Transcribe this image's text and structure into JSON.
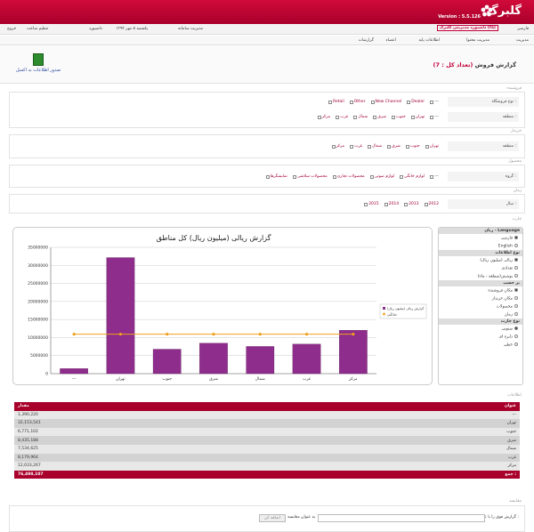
{
  "header": {
    "logo": "گلبرگ",
    "version": "Version : 5.5.126",
    "user_btn": "داشبورد مدیریتی گلبرگ (fa)",
    "language": "فارسی",
    "date": "یکشنبه ۵ مهر ۱۳۹۴",
    "dashboard_link": "داشبورد",
    "settings_link": "تنظیم ساعت",
    "logout": "خروج",
    "system_mgmt": "مدیریت سامانه"
  },
  "menu": {
    "items": [
      "مدیریت",
      "مدیریت محتوا",
      "اطلاعات پایه",
      "اعضاء",
      "گزارشات"
    ]
  },
  "page": {
    "title": "گزارش فروش",
    "count": "(تعداد کل : 7)",
    "excel": "صدور اطلاعات به اکسل"
  },
  "filters": {
    "store_section": "فروشنده",
    "store_type_label": "نوع فروشگاه :",
    "store_types": [
      "---",
      "Dealer",
      "New Channel",
      "Other",
      "Retail"
    ],
    "region_label": "منطقه :",
    "regions": [
      "---",
      "تهران",
      "جنوب",
      "شرق",
      "شمال",
      "غرب",
      "مرکز"
    ],
    "buyer_section": "خریدار",
    "buyer_region_label": "منطقه :",
    "buyer_regions": [
      "تهران",
      "جنوب",
      "شرق",
      "شمال",
      "غرب",
      "مرکز"
    ],
    "product_section": "محصول",
    "group_label": "گروه :",
    "groups": [
      "---",
      "لوازم خانگی",
      "لوازم صوتی",
      "محصولات تجاری",
      "محصولات سلامتی",
      "نمایشگرها"
    ],
    "time_section": "زمان",
    "year_label": "سال :",
    "years": [
      "2012",
      "2013",
      "2014",
      "2015"
    ]
  },
  "chart_section_label": "چارت",
  "chart_data": {
    "type": "bar",
    "title": "گزارش ریالی (میلیون ریال) کل مناطق",
    "categories": [
      "---",
      "تهران",
      "جنوب",
      "شرق",
      "شمال",
      "غرب",
      "مرکز"
    ],
    "series": [
      {
        "name": "گزارش ریالی (میلیون ریال)",
        "values": [
          1390220,
          32153541,
          6771102,
          8435188,
          7534625,
          8179964,
          12033267
        ],
        "color": "#8e2d8c"
      },
      {
        "name": "میانگین",
        "values": [
          10928312,
          10928312,
          10928312,
          10928312,
          10928312,
          10928312,
          10928312
        ],
        "color": "#f0a01e"
      }
    ],
    "yticks": [
      "0",
      "5000000",
      "10000000",
      "15000000",
      "20000000",
      "25000000",
      "30000000",
      "35000000"
    ],
    "ylim": [
      0,
      35000000
    ],
    "grid": true,
    "legend": "right"
  },
  "right_panel": {
    "language_head": "زبان - Language",
    "languages": [
      "فارسی",
      "English"
    ],
    "info_type_head": "نوع اطلاعات",
    "info_types": [
      "ریالی (میلیون ریال)",
      "تعدادی",
      "پوشش(منطقه - ماه)"
    ],
    "basis_head": "بر حسب",
    "bases": [
      "مکان فروشنده",
      "مکان خریدار",
      "محصولات",
      "زمان"
    ],
    "chart_type_head": "نوع چارت",
    "chart_types": [
      "ستونی",
      "دایره ای",
      "خطی"
    ]
  },
  "table": {
    "section_label": "اطلاعات",
    "col_title": "عنوان",
    "col_amount": "مقدار",
    "rows": [
      {
        "title": "---",
        "amount": "1,390,220"
      },
      {
        "title": "تهران",
        "amount": "32,153,541"
      },
      {
        "title": "جنوب",
        "amount": "6,771,102"
      },
      {
        "title": "شرق",
        "amount": "8,435,188"
      },
      {
        "title": "شمال",
        "amount": "7,534,625"
      },
      {
        "title": "غرب",
        "amount": "8,179,964"
      },
      {
        "title": "مرکز",
        "amount": "12,033,267"
      }
    ],
    "total_label": "جمع :",
    "total_amount": "76,498,107"
  },
  "compare": {
    "section_label": "مقایسه",
    "label": "گزارش فوق را با عنوان :",
    "placeholder_text": "به عنوان مقایسه",
    "add_button": "اضافه کن"
  }
}
